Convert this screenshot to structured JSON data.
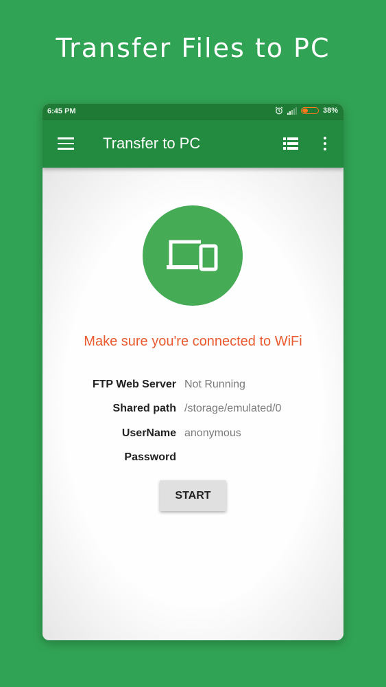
{
  "promo": {
    "title": "Transfer Files to PC"
  },
  "status_bar": {
    "time": "6:45 PM",
    "battery_percent": "38%",
    "battery_level": 0.38,
    "icons": [
      "alarm-icon",
      "signal-icon",
      "battery-icon"
    ],
    "battery_color": "#ff7a1a"
  },
  "app_bar": {
    "title": "Transfer to PC",
    "icons": [
      "menu-icon",
      "list-view-icon",
      "more-vert-icon"
    ],
    "color": "#238b3f"
  },
  "main": {
    "hero_icon": "laptop-phone-icon",
    "hero_color": "#45ab55",
    "warning": "Make sure you're connected to WiFi",
    "warning_color": "#ea5a2f",
    "info": {
      "ftp_label": "FTP Web Server",
      "ftp_value": "Not Running",
      "path_label": "Shared path",
      "path_value": "/storage/emulated/0",
      "user_label": "UserName",
      "user_value": "anonymous",
      "password_label": "Password",
      "password_value": ""
    },
    "start_label": "START"
  }
}
